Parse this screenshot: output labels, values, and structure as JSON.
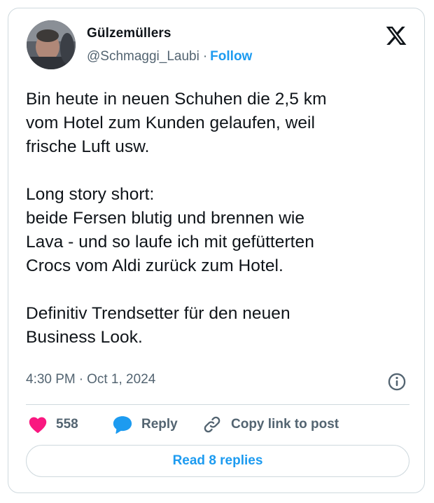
{
  "author": {
    "display_name": "Gülzemüllers",
    "handle": "@Schmaggi_Laubi",
    "separator": "·",
    "follow_label": "Follow"
  },
  "tweet": {
    "text": "Bin heute in neuen Schuhen die 2,5 km\nvom Hotel zum Kunden gelaufen, weil\nfrische Luft usw.\n\nLong story short:\nbeide Fersen blutig und brennen wie\nLava - und so laufe ich mit gefütterten\nCrocs vom Aldi zurück zum Hotel.\n\nDefinitiv Trendsetter für den neuen\nBusiness Look.",
    "time": "4:30 PM",
    "separator": "·",
    "date": "Oct 1, 2024"
  },
  "actions": {
    "like_count": "558",
    "reply_label": "Reply",
    "copy_label": "Copy link to post"
  },
  "read_replies_label": "Read 8 replies",
  "icons": {
    "brand": "x-logo-icon",
    "info": "info-icon",
    "like": "heart-icon",
    "reply": "speech-bubble-icon",
    "copy": "link-icon"
  },
  "colors": {
    "accent": "#1d9bf0",
    "like": "#f91880",
    "secondary_text": "#536471",
    "border": "#cfd9de"
  }
}
